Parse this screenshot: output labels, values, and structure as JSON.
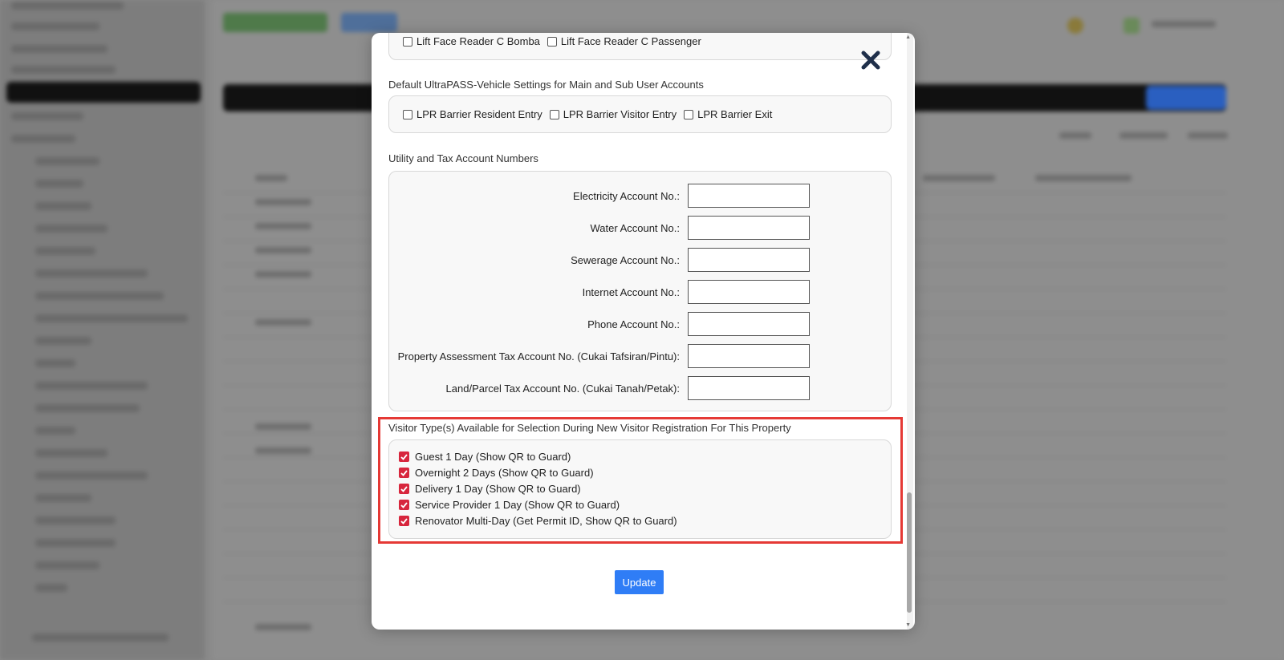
{
  "modal": {
    "top_checkboxes": [
      {
        "label": "Lift Face Reader C Bomba",
        "checked": false
      },
      {
        "label": "Lift Face Reader C Passenger",
        "checked": false
      }
    ],
    "vehicle_section": {
      "title": "Default UltraPASS-Vehicle Settings for Main and Sub User Accounts",
      "options": [
        {
          "label": "LPR Barrier Resident Entry",
          "checked": false
        },
        {
          "label": "LPR Barrier Visitor Entry",
          "checked": false
        },
        {
          "label": "LPR Barrier Exit",
          "checked": false
        }
      ]
    },
    "utility_section": {
      "title": "Utility and Tax Account Numbers",
      "fields": [
        {
          "label": "Electricity Account No.:",
          "value": ""
        },
        {
          "label": "Water Account No.:",
          "value": ""
        },
        {
          "label": "Sewerage Account No.:",
          "value": ""
        },
        {
          "label": "Internet Account No.:",
          "value": ""
        },
        {
          "label": "Phone Account No.:",
          "value": ""
        },
        {
          "label": "Property Assessment Tax Account No. (Cukai Tafsiran/Pintu):",
          "value": ""
        },
        {
          "label": "Land/Parcel Tax Account No. (Cukai Tanah/Petak):",
          "value": ""
        }
      ]
    },
    "visitor_section": {
      "title": "Visitor Type(s) Available for Selection During New Visitor Registration For This Property",
      "options": [
        {
          "label": "Guest 1 Day (Show QR to Guard)",
          "checked": true
        },
        {
          "label": "Overnight 2 Days (Show QR to Guard)",
          "checked": true
        },
        {
          "label": "Delivery 1 Day (Show QR to Guard)",
          "checked": true
        },
        {
          "label": "Service Provider 1 Day (Show QR to Guard)",
          "checked": true
        },
        {
          "label": "Renovator Multi-Day (Get Permit ID, Show QR to Guard)",
          "checked": true
        }
      ]
    },
    "update_label": "Update",
    "close_icon": "close-x-icon"
  },
  "colors": {
    "accent_checked": "#d7263d",
    "highlight_border": "#e53935",
    "update_button": "#2f7df6",
    "close_icon": "#1f2f4a"
  }
}
